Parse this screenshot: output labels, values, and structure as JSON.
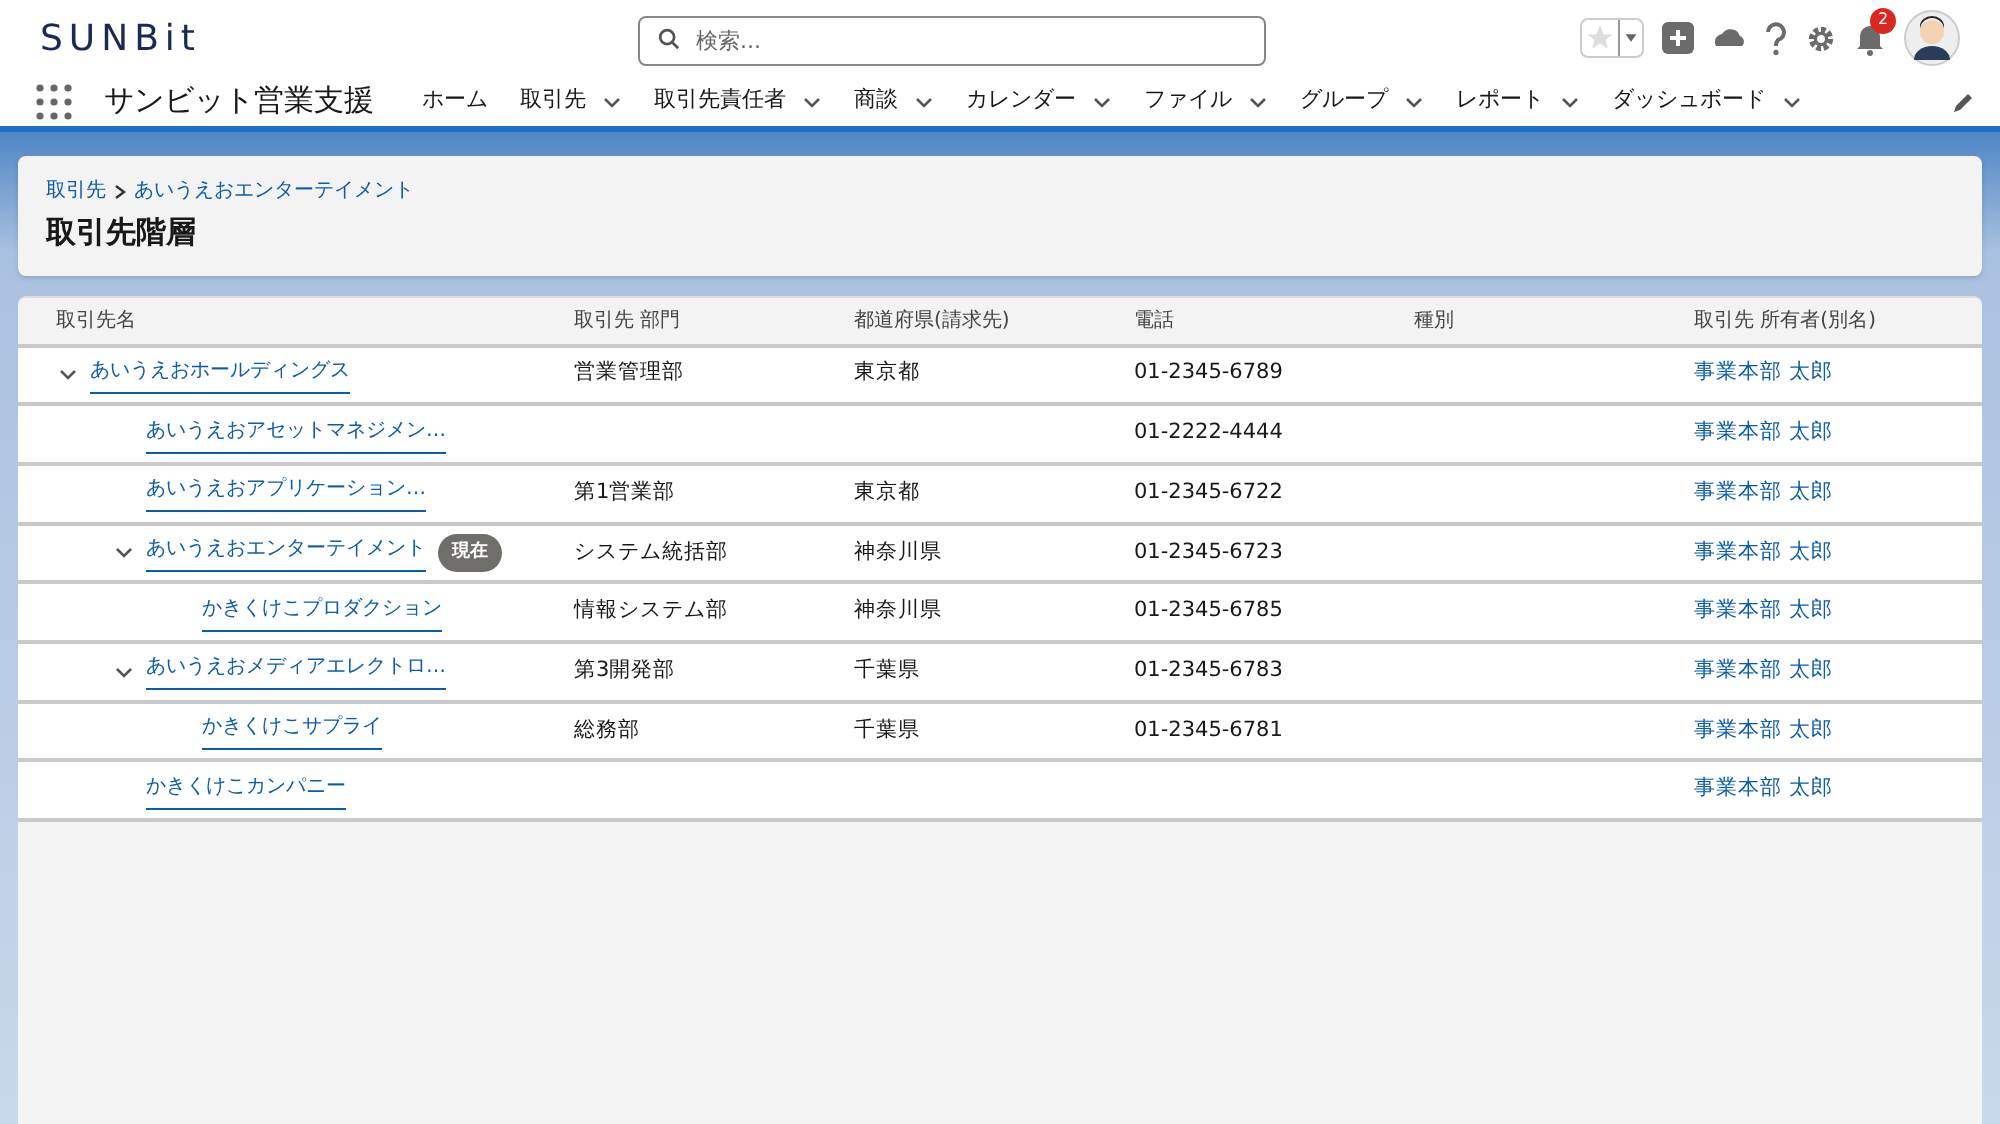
{
  "header": {
    "logo": "SUNBit",
    "search": {
      "placeholder": "検索..."
    },
    "notifications": "2"
  },
  "nav": {
    "app_name": "サンビット営業支援",
    "items": [
      {
        "label": "ホーム",
        "dropdown": false
      },
      {
        "label": "取引先",
        "dropdown": true
      },
      {
        "label": "取引先責任者",
        "dropdown": true
      },
      {
        "label": "商談",
        "dropdown": true
      },
      {
        "label": "カレンダー",
        "dropdown": true
      },
      {
        "label": "ファイル",
        "dropdown": true
      },
      {
        "label": "グループ",
        "dropdown": true
      },
      {
        "label": "レポート",
        "dropdown": true
      },
      {
        "label": "ダッシュボード",
        "dropdown": true
      }
    ]
  },
  "page_header": {
    "breadcrumb": [
      "取引先",
      "あいうえおエンターテイメント"
    ],
    "title": "取引先階層"
  },
  "table": {
    "columns": [
      "取引先名",
      "取引先 部門",
      "都道府県(請求先)",
      "電話",
      "種別",
      "取引先 所有者(別名)"
    ],
    "rows": [
      {
        "name": "あいうえおホールディングス",
        "expanded": true,
        "department": "営業管理部",
        "prefecture": "東京都",
        "phone": "01-2345-6789",
        "owner": "事業本部 太郎",
        "children": [
          {
            "name": "あいうえおアセットマネジメン…",
            "phone": "01-2222-4444",
            "owner": "事業本部 太郎"
          },
          {
            "name": "あいうえおアプリケーション…",
            "department": "第1営業部",
            "prefecture": "東京都",
            "phone": "01-2345-6722",
            "owner": "事業本部 太郎"
          },
          {
            "name": "あいうえおエンターテイメント",
            "badge": "現在",
            "expanded": true,
            "department": "システム統括部",
            "prefecture": "神奈川県",
            "phone": "01-2345-6723",
            "owner": "事業本部 太郎",
            "children": [
              {
                "name": "かきくけこプロダクション",
                "department": "情報システム部",
                "prefecture": "神奈川県",
                "phone": "01-2345-6785",
                "owner": "事業本部 太郎"
              }
            ]
          },
          {
            "name": "あいうえおメディアエレクトロ…",
            "expanded": true,
            "department": "第3開発部",
            "prefecture": "千葉県",
            "phone": "01-2345-6783",
            "owner": "事業本部 太郎",
            "children": [
              {
                "name": "かきくけこサプライ",
                "department": "総務部",
                "prefecture": "千葉県",
                "phone": "01-2345-6781",
                "owner": "事業本部 太郎"
              }
            ]
          },
          {
            "name": "かきくけこカンパニー",
            "owner": "事業本部 太郎"
          }
        ]
      }
    ]
  }
}
